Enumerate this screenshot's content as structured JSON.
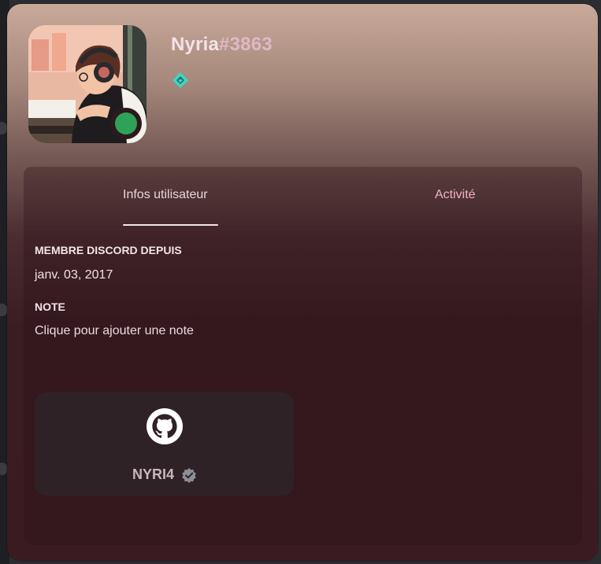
{
  "profile": {
    "username": "Nyria",
    "discriminator": "#3863",
    "badge_icon": "hypesquad-balance-icon",
    "status": "online",
    "status_color": "#2fa25a"
  },
  "tabs": [
    {
      "label": "Infos utilisateur",
      "active": true
    },
    {
      "label": "Activité",
      "active": false
    }
  ],
  "sections": {
    "member_since": {
      "heading": "MEMBRE DISCORD DEPUIS",
      "value": "janv. 03, 2017"
    },
    "note": {
      "heading": "NOTE",
      "placeholder": "Clique pour ajouter une note"
    }
  },
  "connections": [
    {
      "service_icon": "github-icon",
      "name": "NYRI4",
      "verified": true
    }
  ],
  "colors": {
    "accent_tab": "#f0b2c7",
    "badge": "#3fd6c0"
  }
}
